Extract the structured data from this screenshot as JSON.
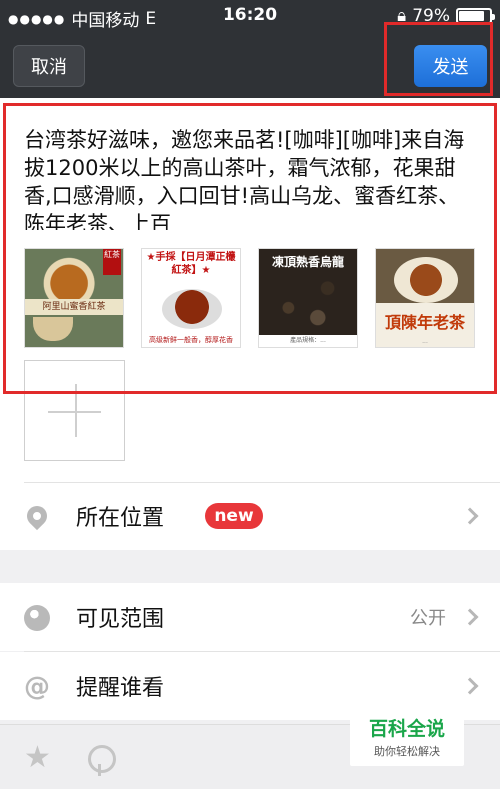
{
  "status_bar": {
    "carrier": "中国移动",
    "network": "E",
    "time": "16:20",
    "battery_percent": "79%",
    "battery_level": 0.79
  },
  "nav": {
    "cancel_label": "取消",
    "send_label": "发送"
  },
  "compose": {
    "text": "台湾茶好滋味，邀您来品茗![咖啡][咖啡]来自海拔1200米以上的高山茶叶，霜气浓郁，花果甜香,口感滑顺，入口回甘!高山乌龙、蜜香红茶、陈年老茶、上百",
    "thumbnails": [
      {
        "caption": "阿里山蜜香紅茶",
        "badge": "紅茶",
        "icon": "tea-photo-icon"
      },
      {
        "caption": "★手採【日月潭正欉紅茶】★",
        "footer": "高级新鲜一般香，醇厚花香",
        "icon": "tea-photo-icon"
      },
      {
        "caption": "凍頂熟香烏龍",
        "footer": "產品規格：...",
        "icon": "tea-leaves-photo-icon"
      },
      {
        "caption": "頂陳年老茶",
        "footer": "...",
        "icon": "tea-photo-icon"
      }
    ]
  },
  "options": {
    "location_label": "所在位置",
    "location_badge": "new",
    "visibility_label": "可见范围",
    "visibility_value": "公开",
    "remind_label": "提醒谁看"
  },
  "watermark": {
    "title": "百科全说",
    "subtitle": "助你轻松解决"
  },
  "colors": {
    "nav_bg": "#2f3236",
    "send_blue": "#1d6fd8",
    "highlight_red": "#e12a2a",
    "badge_red": "#e8373a",
    "watermark_green": "#1aa64a"
  }
}
